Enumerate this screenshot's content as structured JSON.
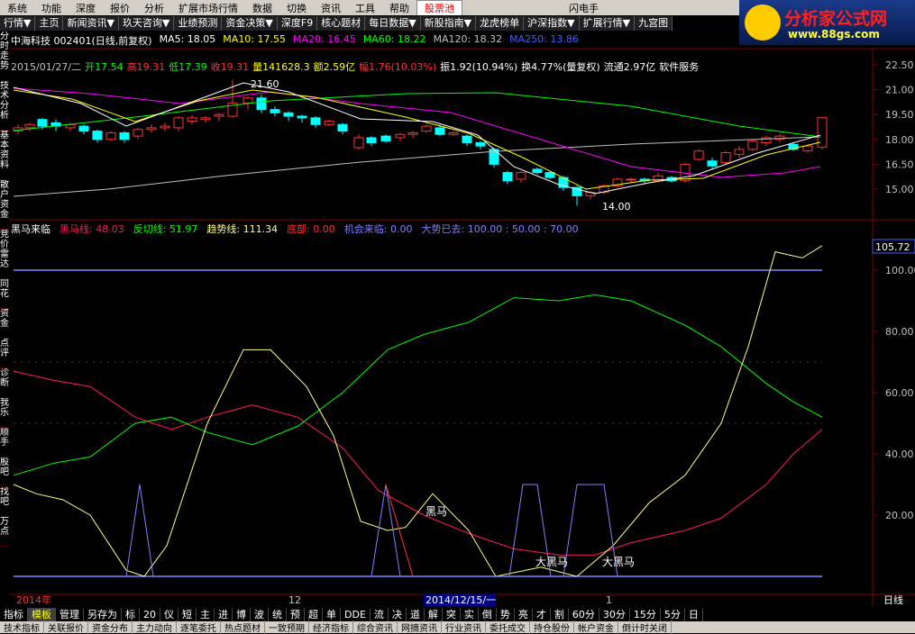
{
  "menu": [
    "系统",
    "功能",
    "深度",
    "报价",
    "分析",
    "扩展市场行情",
    "数据",
    "切换",
    "资讯",
    "工具",
    "帮助"
  ],
  "pool_label": "股票池",
  "flash_label": "闪电手",
  "logo": {
    "title": "分析家公式网",
    "url": "www.88gs.com"
  },
  "toolbar": [
    "行情▼",
    "主页",
    "新闻资讯▼",
    "玖天咨询▼",
    "业绩预测",
    "资金决策▼",
    "深度F9",
    "核心题材",
    "每日数据▼",
    "新股指南▼",
    "龙虎榜单",
    "沪深指数▼",
    "扩展行情▼",
    "九宫图"
  ],
  "left_tabs": [
    "分时走势",
    "技术分析",
    "基本资料",
    "散户资金",
    "竞价雷达",
    "同花",
    "资金",
    "点评",
    "诊断",
    "我乐",
    "顺手",
    "股吧",
    "找吧",
    "万点"
  ],
  "stock_info": {
    "name": "中海科技 002401(日线,前复权)",
    "ma5": "MA5: 18.05",
    "ma10": "MA10: 17.55",
    "ma20": "MA20: 16.45",
    "ma60": "MA60: 18.22",
    "ma120": "MA120: 18.32",
    "ma250": "MA250: 13.86"
  },
  "ohlc": {
    "date": "2015/01/27/二",
    "open": "开17.54",
    "high": "高19.31",
    "low": "低17.39",
    "close": "收19.31",
    "vol": "量141628.3",
    "amount": "额2.59亿",
    "change": "幅1.76(10.03%)",
    "amp": "振1.92(10.94%)",
    "turnover": "换4.77%(量复权)",
    "float": "流通2.97亿",
    "sector": "软件服务"
  },
  "price_axis": [
    "22.50",
    "21.00",
    "19.50",
    "18.00",
    "16.50",
    "15.00"
  ],
  "price_annotations": {
    "high": "21.60",
    "low": "14.00"
  },
  "indicator": {
    "name": "黑马来临",
    "heima": "黑马线: 48.03",
    "fanqie": "反切线: 51.97",
    "qushi": "趋势线: 111.34",
    "dibu": "底部: 0.00",
    "jihui": "机会来临: 0.00",
    "dashi": "大势已去: 100.00 : 50.00 : 70.00"
  },
  "ind_axis": [
    "100.00",
    "80.00",
    "60.00",
    "40.00",
    "20.00"
  ],
  "ind_current": "105.72",
  "ind_labels": [
    "黑马",
    "大黑马",
    "大黑马"
  ],
  "time_axis": {
    "year": "2014年",
    "m12": "12",
    "cursor": "2014/12/15/一",
    "m1": "1",
    "period": "日线"
  },
  "bottom_tabs": [
    "指标",
    "模板",
    "管理",
    "另存为",
    "标",
    "20",
    "仪",
    "短",
    "主",
    "进",
    "博",
    "波",
    "统",
    "预",
    "超",
    "单",
    "DDE",
    "流",
    "决",
    "道",
    "解",
    "突",
    "实",
    "倒",
    "势",
    "亮",
    "才",
    "割",
    "60分",
    "30分",
    "15分",
    "5分",
    "日"
  ],
  "bottom2": [
    "技术指标",
    "关联报价",
    "资金分布",
    "主力动向",
    "逐笔委托",
    "热点题材",
    "一致预期",
    "经济指标",
    "综合资讯",
    "网摘资讯",
    "行业资讯",
    "委托成交",
    "持仓股份",
    "帐户资金",
    "倒计时关闭"
  ],
  "colors": {
    "up": "#ff3232",
    "down": "#00ffff",
    "ma5": "#ffffff",
    "ma10": "#ffff00",
    "ma20": "#ff00ff",
    "ma60": "#00ff00",
    "heima": "#ff1a5a",
    "fanqie": "#00ff00",
    "qushi": "#ffff80",
    "signal": "#8080ff"
  }
}
